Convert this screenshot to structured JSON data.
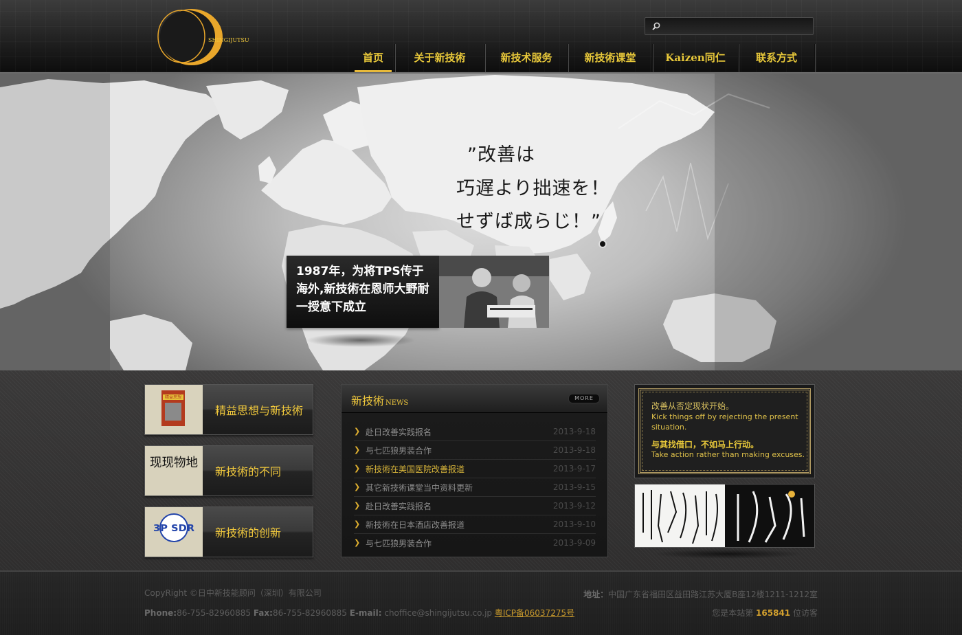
{
  "header": {
    "logo_text": "SHINGIJUTSU",
    "search": {
      "placeholder": ""
    },
    "nav": [
      {
        "label": "首页",
        "active": true
      },
      {
        "label": "关于新技術",
        "active": false
      },
      {
        "label": "新技术服务",
        "active": false
      },
      {
        "label": "新技術课堂",
        "active": false
      },
      {
        "label": "Kaizen同仁",
        "active": false
      },
      {
        "label": "联系方式",
        "active": false
      }
    ]
  },
  "banner": {
    "quote_line1": "”改善は",
    "quote_line2": "巧遅より拙速を！",
    "quote_line3": "せずば成らじ！”",
    "caption": "1987年，为将TPS传于海外,新技術在恩师大野耐一授意下成立"
  },
  "features": [
    {
      "label": "精益思想与新技術",
      "thumb_text": "精益思想"
    },
    {
      "label": "新技術的不同",
      "thumb_text": "现现物地"
    },
    {
      "label": "新技術的创新",
      "thumb_text": "3P SDR"
    }
  ],
  "news": {
    "title": "新技術",
    "subtitle": "NEWS",
    "more_label": "MORE",
    "items": [
      {
        "title": "赴日改善实践报名",
        "date": "2013-9-18",
        "highlight": false
      },
      {
        "title": "与七匹狼男装合作",
        "date": "2013-9-18",
        "highlight": false
      },
      {
        "title": "新技術在美国医院改善报道",
        "date": "2013-9-17",
        "highlight": true
      },
      {
        "title": "其它新技術课堂当中资料更新",
        "date": "2013-9-15",
        "highlight": false
      },
      {
        "title": "赴日改善实践报名",
        "date": "2013-9-12",
        "highlight": false
      },
      {
        "title": "新技術在日本酒店改善报道",
        "date": "2013-9-10",
        "highlight": false
      },
      {
        "title": "与七匹狼男装合作",
        "date": "2013-9-09",
        "highlight": false
      }
    ]
  },
  "motto": {
    "line0": "改善从否定现状开始。",
    "line1": "Kick things off by rejecting the present",
    "line2": "situation.",
    "line3": "与其找借口，不如马上行动。",
    "line4": "Take action rather than making excuses."
  },
  "footer": {
    "copyright": "CopyRight ©日中新技能顾问（深圳）有限公司",
    "phone_label": "Phone:",
    "phone": "86-755-82960885",
    "fax_label": "Fax:",
    "fax": "86-755-82960885",
    "email_label": "E-mail:",
    "email": "choffice@shingijutsu.co.jp",
    "icp": "粤ICP备06037275号",
    "address_label": "地址：",
    "address": "中国广东省福田区益田路江苏大厦B座12楼1211-1212室",
    "visitor_prefix": "您是本站第",
    "visitor_count": "165841",
    "visitor_suffix": "位访客"
  },
  "colors": {
    "accent_gold": "#f0c83c",
    "nav_gold": "#e8c83a",
    "link_gold": "#c99a2c"
  }
}
